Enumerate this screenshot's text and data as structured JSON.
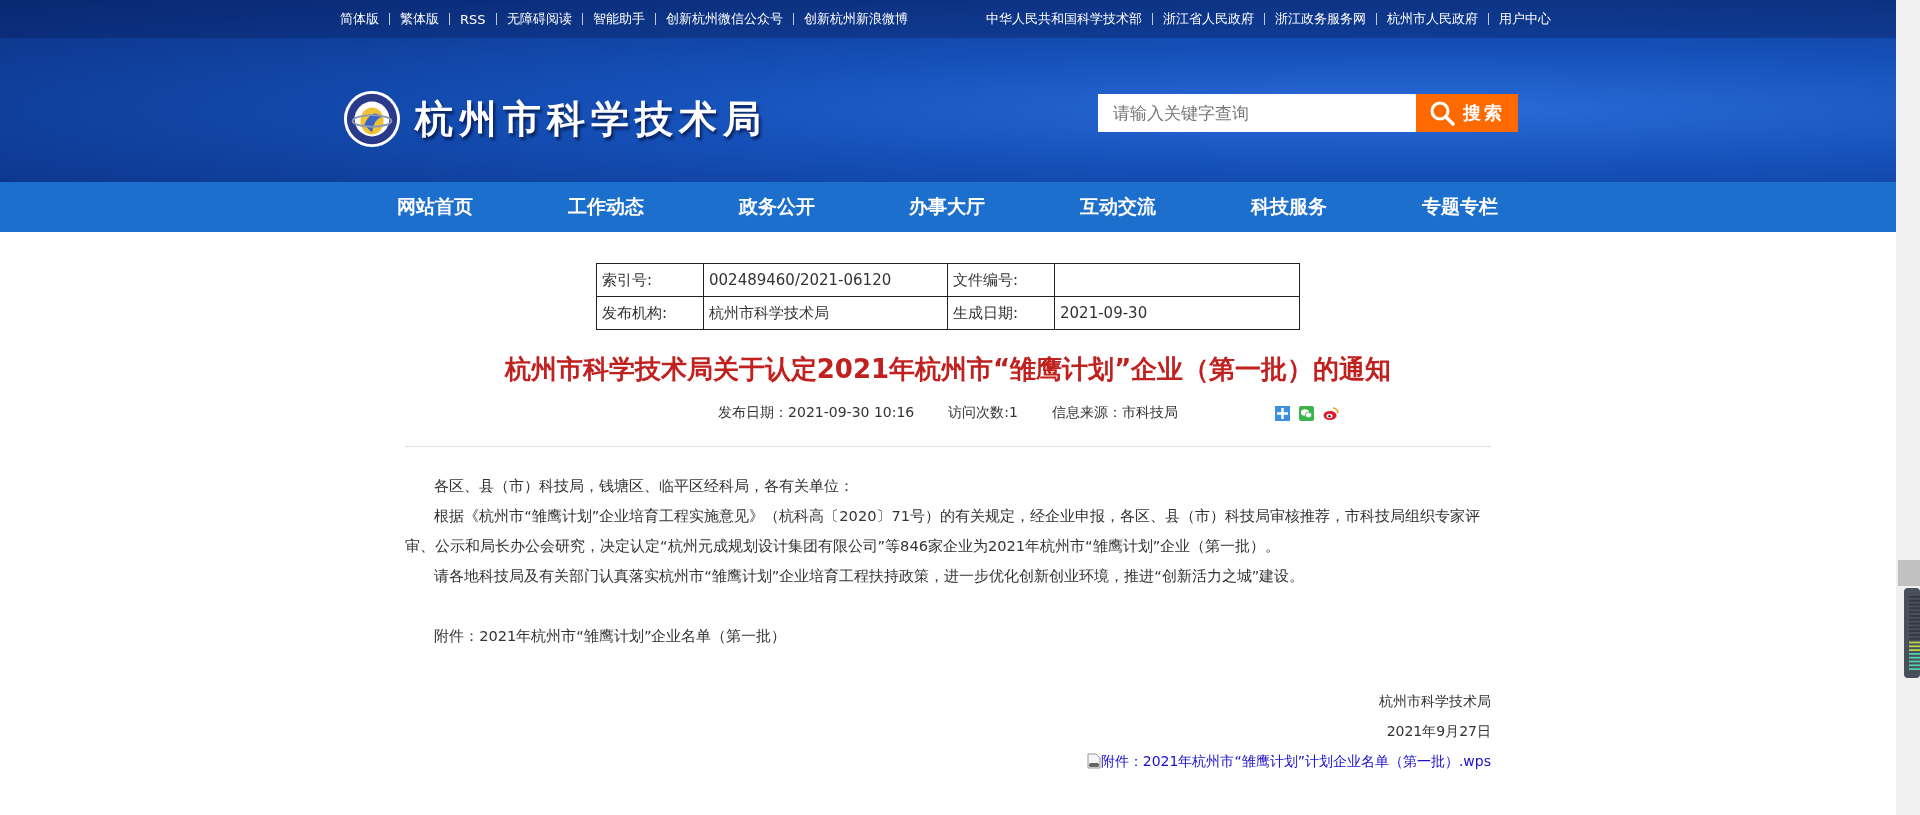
{
  "top_links_left": [
    "简体版",
    "繁体版",
    "RSS",
    "无障碍阅读",
    "智能助手",
    "创新杭州微信公众号",
    "创新杭州新浪微博"
  ],
  "top_links_right": [
    "中华人民共和国科学技术部",
    "浙江省人民政府",
    "浙江政务服务网",
    "杭州市人民政府",
    "用户中心"
  ],
  "header": {
    "site_title": "杭州市科学技术局",
    "search": {
      "placeholder": "请输入关键字查询"
    },
    "search_button": "搜索"
  },
  "nav": [
    "网站首页",
    "工作动态",
    "政务公开",
    "办事大厅",
    "互动交流",
    "科技服务",
    "专题专栏"
  ],
  "info_table": [
    [
      {
        "label": "索引号:",
        "value": "002489460/2021-06120"
      },
      {
        "label": "文件编号:"
      }
    ],
    [
      {
        "label": "发布机构:",
        "value": "杭州市科学技术局"
      },
      {
        "label": "生成日期:",
        "value": "2021-09-30"
      }
    ]
  ],
  "article": {
    "title": "杭州市科学技术局关于认定2021年杭州市“雏鹰计划”企业（第一批）的通知",
    "meta": [
      "发布日期：2021-09-30 10:16",
      "访问次数:1",
      "信息来源：市科技局"
    ],
    "share": [
      {
        "kind": "plus"
      },
      {
        "kind": "wechat"
      },
      {
        "kind": "weibo"
      }
    ],
    "paragraphs": [
      "各区、县（市）科技局，钱塘区、临平区经科局，各有关单位：",
      "根据《杭州市“雏鹰计划”企业培育工程实施意见》（杭科高〔2020〕71号）的有关规定，经企业申报，各区、县（市）科技局审核推荐，市科技局组织专家评审、公示和局长办公会研究，决定认定“杭州元成规划设计集团有限公司”等846家企业为2021年杭州市“雏鹰计划”企业（第一批）。",
      "请各地科技局及有关部门认真落实杭州市“雏鹰计划”企业培育工程扶持政策，进一步优化创新创业环境，推进“创新活力之城”建设。"
    ],
    "attachment_note": "附件：2021年杭州市“雏鹰计划”企业名单（第一批）",
    "signature": "杭州市科学技术局",
    "date": "2021年9月27日",
    "attachment_link": "附件：2021年杭州市“雏鹰计划”计划企业名单（第一批）.wps"
  }
}
